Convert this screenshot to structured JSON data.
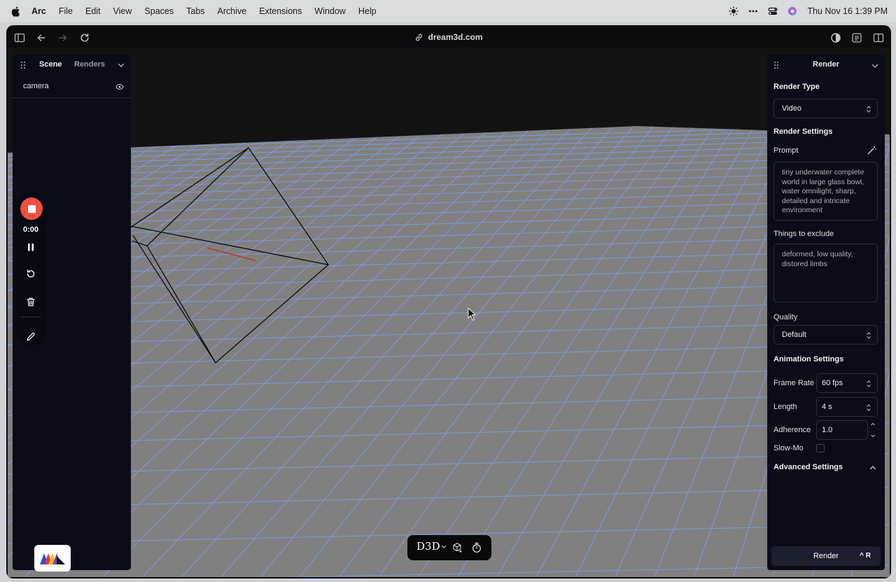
{
  "menubar": {
    "app": "Arc",
    "items": [
      "File",
      "Edit",
      "View",
      "Spaces",
      "Tabs",
      "Archive",
      "Extensions",
      "Window",
      "Help"
    ],
    "clock": "Thu Nov 16  1:39 PM"
  },
  "browser": {
    "url": "dream3d.com"
  },
  "scene_panel": {
    "tabs": [
      "Scene",
      "Renders"
    ],
    "objects": [
      {
        "label": "camera"
      }
    ]
  },
  "recorder": {
    "time": "0:00"
  },
  "dock": {
    "logo": "D3D"
  },
  "render_panel": {
    "title": "Render",
    "render_type_label": "Render Type",
    "render_type_value": "Video",
    "render_settings_label": "Render Settings",
    "prompt_label": "Prompt",
    "prompt_text": "tiny underwater complete world in large glass bowl, water omnilight, sharp, detailed and intricate environment",
    "exclude_label": "Things to exclude",
    "exclude_text": "deformed, low quality, distored limbs",
    "quality_label": "Quality",
    "quality_value": "Default",
    "animation_settings_label": "Animation Settings",
    "frame_rate_label": "Frame Rate",
    "frame_rate_value": "60 fps",
    "length_label": "Length",
    "length_value": "4 s",
    "adherence_label": "Adherence",
    "adherence_value": "1.0",
    "slowmo_label": "Slow-Mo",
    "advanced_label": "Advanced Settings",
    "render_button": "Render",
    "render_shortcut": "^ R"
  },
  "colors": {
    "record": "#ef4f3e",
    "grid_line": "#7f9ad8",
    "ground": "#808080",
    "panel_bg": "#0a0d17"
  }
}
